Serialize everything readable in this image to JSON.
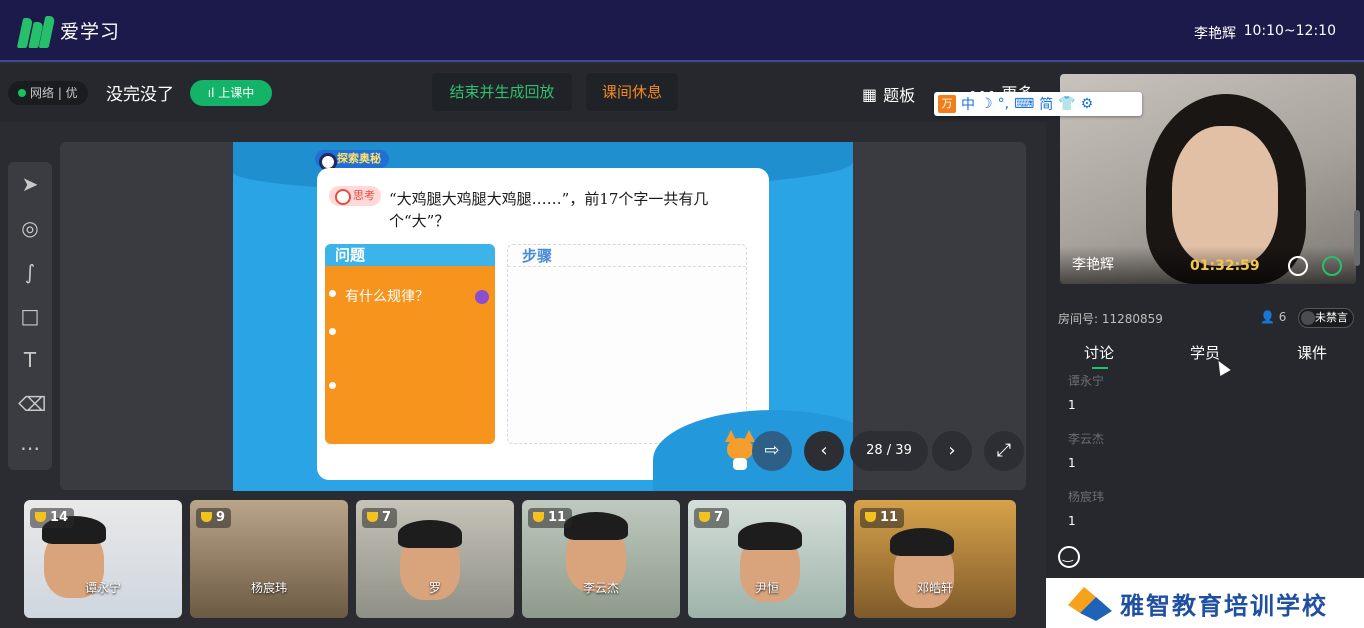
{
  "header": {
    "app_name": "爱学习",
    "user_name": "李艳辉",
    "time_range": "10:10~12:10"
  },
  "toolbar": {
    "network_status": "网络 | 优",
    "course_title": "没完没了",
    "live_status": "上课中",
    "end_button": "结束并生成回放",
    "break_button": "课间休息",
    "quiz_button": "题板",
    "more_button": "更多"
  },
  "ime_bar": {
    "items": [
      "中",
      "简"
    ]
  },
  "tools": [
    "cursor-icon",
    "laser-icon",
    "pen-icon",
    "rectangle-icon",
    "text-icon",
    "eraser-icon",
    "more-icon"
  ],
  "slide": {
    "badge": "探索奥秘",
    "think_tag": "思考",
    "question": "“大鸡腿大鸡腿大鸡腿……”，前17个字一共有几个“大”？",
    "problem_header": "问题",
    "problem_bullet": "有什么规律？",
    "steps_header": "步骤"
  },
  "pager": {
    "current_page": 28,
    "total_pages": 39,
    "label": "28 / 39"
  },
  "students": [
    {
      "name": "谭永宁",
      "trophies": "14"
    },
    {
      "name": "杨宸玮",
      "trophies": "9"
    },
    {
      "name": "罗",
      "trophies": "7"
    },
    {
      "name": "李云杰",
      "trophies": "11"
    },
    {
      "name": "尹恒",
      "trophies": "7"
    },
    {
      "name": "邓皓轩",
      "trophies": "11"
    }
  ],
  "teacher_cam": {
    "name": "李艳辉",
    "timer": "01:32:59"
  },
  "room": {
    "room_id": "房间号: 11280859",
    "online_count": "6",
    "mute_label": "未禁言"
  },
  "tabs": [
    "讨论",
    "学员",
    "课件"
  ],
  "messages": [
    {
      "name": "谭永宁",
      "text": "1"
    },
    {
      "name": "李云杰",
      "text": "1"
    },
    {
      "name": "杨宸玮",
      "text": "1"
    }
  ],
  "watermark": "雅智教育培训学校",
  "colors": {
    "brand_green": "#27c06a",
    "end_button_text": "#2fbf6d",
    "break_button_text": "#f08a24",
    "timer": "#f2c94c",
    "slide_blue": "#2aa4e4",
    "problem_orange": "#f7941d"
  }
}
